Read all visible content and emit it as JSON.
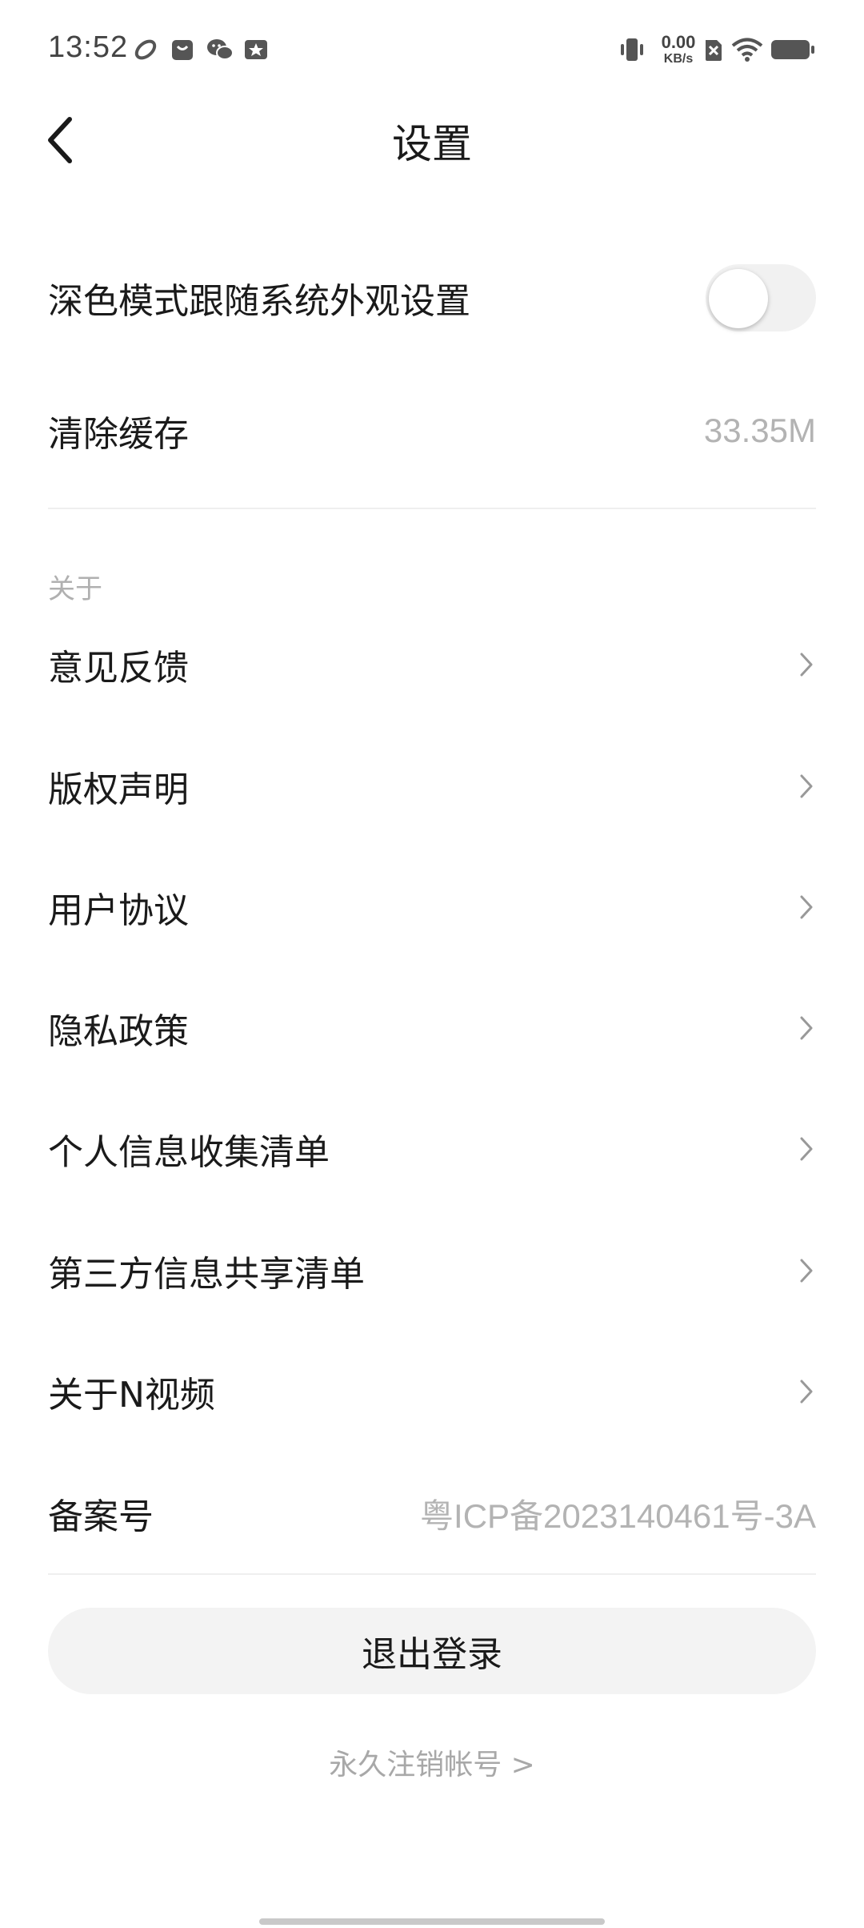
{
  "status_bar": {
    "time": "13:52",
    "net_speed_value": "0.00",
    "net_speed_unit": "KB/s",
    "icons": [
      "app-ring-icon",
      "bag-icon",
      "wechat-icon",
      "star-badge-icon",
      "vibrate-icon",
      "sim-off-icon",
      "wifi-icon",
      "battery-icon"
    ]
  },
  "header": {
    "title": "设置",
    "back_icon": "chevron-left-icon"
  },
  "settings": {
    "dark_mode": {
      "label": "深色模式跟随系统外观设置",
      "enabled": false
    },
    "clear_cache": {
      "label": "清除缓存",
      "value": "33.35M"
    }
  },
  "about": {
    "header": "关于",
    "items": [
      {
        "label": "意见反馈"
      },
      {
        "label": "版权声明"
      },
      {
        "label": "用户协议"
      },
      {
        "label": "隐私政策"
      },
      {
        "label": "个人信息收集清单"
      },
      {
        "label": "第三方信息共享清单"
      },
      {
        "label": "关于N视频"
      }
    ],
    "icp": {
      "label": "备案号",
      "value": "粤ICP备2023140461号-3A"
    }
  },
  "actions": {
    "logout_label": "退出登录",
    "delete_account_label": "永久注销帐号 >"
  },
  "colors": {
    "text_primary": "#1a1a1a",
    "text_secondary": "#b3b3b3",
    "divider": "#efefef",
    "button_bg": "#f3f3f3"
  }
}
